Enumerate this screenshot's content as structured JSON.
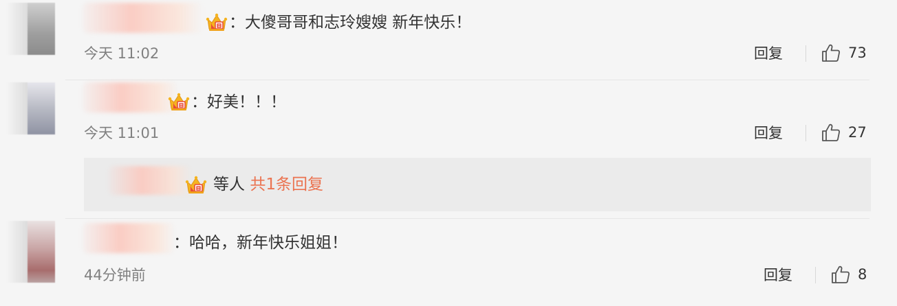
{
  "comments": [
    {
      "text": "：大傻哥哥和志玲嫂嫂 新年快乐！",
      "time": "今天 11:02",
      "reply_label": "回复",
      "likes": "73"
    },
    {
      "text": "：好美！！！",
      "time": "今天 11:01",
      "reply_label": "回复",
      "likes": "27",
      "replies": {
        "suffix": "等人",
        "more": "共1条回复"
      }
    },
    {
      "text": "：哈哈，新年快乐姐姐！",
      "time": "44分钟前",
      "reply_label": "回复",
      "likes": "8"
    }
  ],
  "icons": {
    "badge": "vip-crown-icon",
    "like": "thumbs-up-icon"
  },
  "colors": {
    "background": "#f5f5f5",
    "link": "#eb7350",
    "crown_gold": "#f5b31f",
    "crown_red": "#e84a3a"
  }
}
